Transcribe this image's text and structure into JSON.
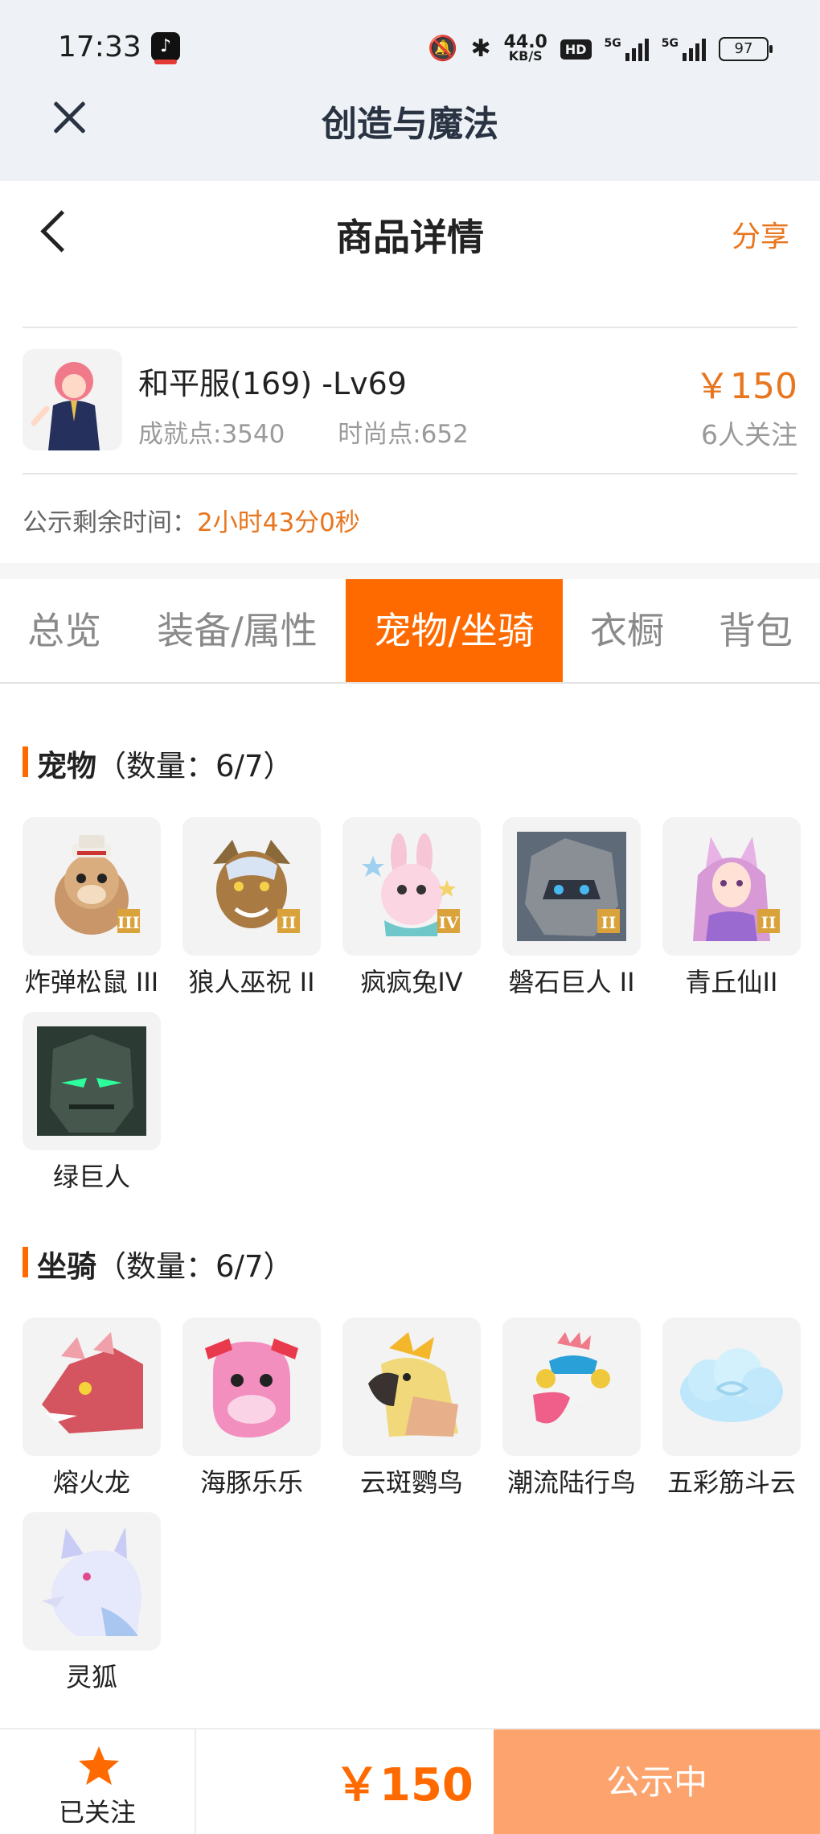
{
  "status_bar": {
    "time": "17:33",
    "net_speed_value": "44.0",
    "net_speed_unit": "KB/S",
    "hd_label": "HD",
    "signal1_label": "5G",
    "signal2_label": "5G",
    "battery": "97"
  },
  "app_header": {
    "title": "创造与魔法"
  },
  "page_header": {
    "title": "商品详情",
    "share_label": "分享"
  },
  "account": {
    "name": "和平服(169) -Lv69",
    "achievement": "成就点:3540",
    "fashion": "时尚点:652",
    "price": "￥150",
    "followers": "6人关注"
  },
  "countdown": {
    "label": "公示剩余时间：",
    "value": "2小时43分0秒"
  },
  "tabs": [
    {
      "label": "总览"
    },
    {
      "label": "装备/属性"
    },
    {
      "label": "宠物/坐骑"
    },
    {
      "label": "衣橱"
    },
    {
      "label": "背包"
    }
  ],
  "pets": {
    "title": "宠物",
    "count": "（数量：6/7）",
    "items": [
      {
        "label": "炸弹松鼠 III",
        "icon": "squirrel-pet-icon"
      },
      {
        "label": "狼人巫祝 II",
        "icon": "werewolf-pet-icon"
      },
      {
        "label": "疯疯兔IV",
        "icon": "rabbit-pet-icon"
      },
      {
        "label": "磐石巨人 II",
        "icon": "rock-giant-pet-icon"
      },
      {
        "label": "青丘仙II",
        "icon": "fox-fairy-pet-icon"
      },
      {
        "label": "绿巨人",
        "icon": "green-giant-pet-icon"
      }
    ]
  },
  "mounts": {
    "title": "坐骑",
    "count": "（数量：6/7）",
    "items": [
      {
        "label": "熔火龙",
        "icon": "dragon-mount-icon"
      },
      {
        "label": "海豚乐乐",
        "icon": "dolphin-mount-icon"
      },
      {
        "label": "云斑鹦鸟",
        "icon": "parrot-mount-icon"
      },
      {
        "label": "潮流陆行鸟",
        "icon": "bird-mount-icon"
      },
      {
        "label": "五彩筋斗云",
        "icon": "cloud-mount-icon"
      },
      {
        "label": "灵狐",
        "icon": "spirit-fox-mount-icon"
      }
    ]
  },
  "bottom_bar": {
    "follow_label": "已关注",
    "price": "￥150",
    "status_label": "公示中"
  },
  "colors": {
    "accent": "#ff6a00",
    "price": "#e8761e",
    "status_button": "#fda46e"
  }
}
